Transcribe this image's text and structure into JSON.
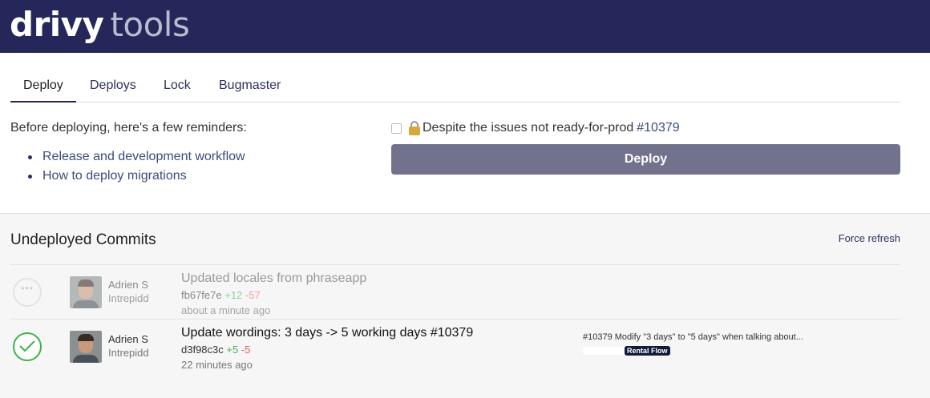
{
  "app": {
    "brand": "drivy",
    "suffix": "tools"
  },
  "tabs": [
    {
      "label": "Deploy",
      "active": true
    },
    {
      "label": "Deploys",
      "active": false
    },
    {
      "label": "Lock",
      "active": false
    },
    {
      "label": "Bugmaster",
      "active": false
    }
  ],
  "deploy_panel": {
    "reminder_intro": "Before deploying, here's a few reminders:",
    "reminder_links": [
      "Release and development workflow",
      "How to deploy migrations"
    ],
    "override_checked": false,
    "override_text": "Despite the issues not ready-for-prod",
    "override_issue": "#10379",
    "deploy_button": "Deploy"
  },
  "commits": {
    "title": "Undeployed Commits",
    "force_refresh": "Force refresh",
    "rows": [
      {
        "status": "pending",
        "status_icon": "pending-dots-icon",
        "author": "Adrien S",
        "team": "Intrepidd",
        "message": "Updated locales from phraseapp",
        "sha": "fb67fe7e",
        "additions": "+12",
        "deletions": "-57",
        "time": "about a minute ago",
        "issue_title": "",
        "labels": []
      },
      {
        "status": "success",
        "status_icon": "check-circle-icon",
        "author": "Adrien S",
        "team": "Intrepidd",
        "message": "Update wordings: 3 days -> 5 working days #10379",
        "sha": "d3f98c3c",
        "additions": "+5",
        "deletions": "-5",
        "time": "22 minutes ago",
        "issue_title": "#10379 Modify \"3 days\" to \"5 days\" when talking about...",
        "labels": [
          "Rental Flow"
        ]
      }
    ]
  },
  "colors": {
    "header_bg": "#25275a",
    "deploy_button_bg": "#71738d",
    "success": "#3cb34a",
    "deletion": "#e45b5b",
    "label_bg": "#111a3a"
  }
}
